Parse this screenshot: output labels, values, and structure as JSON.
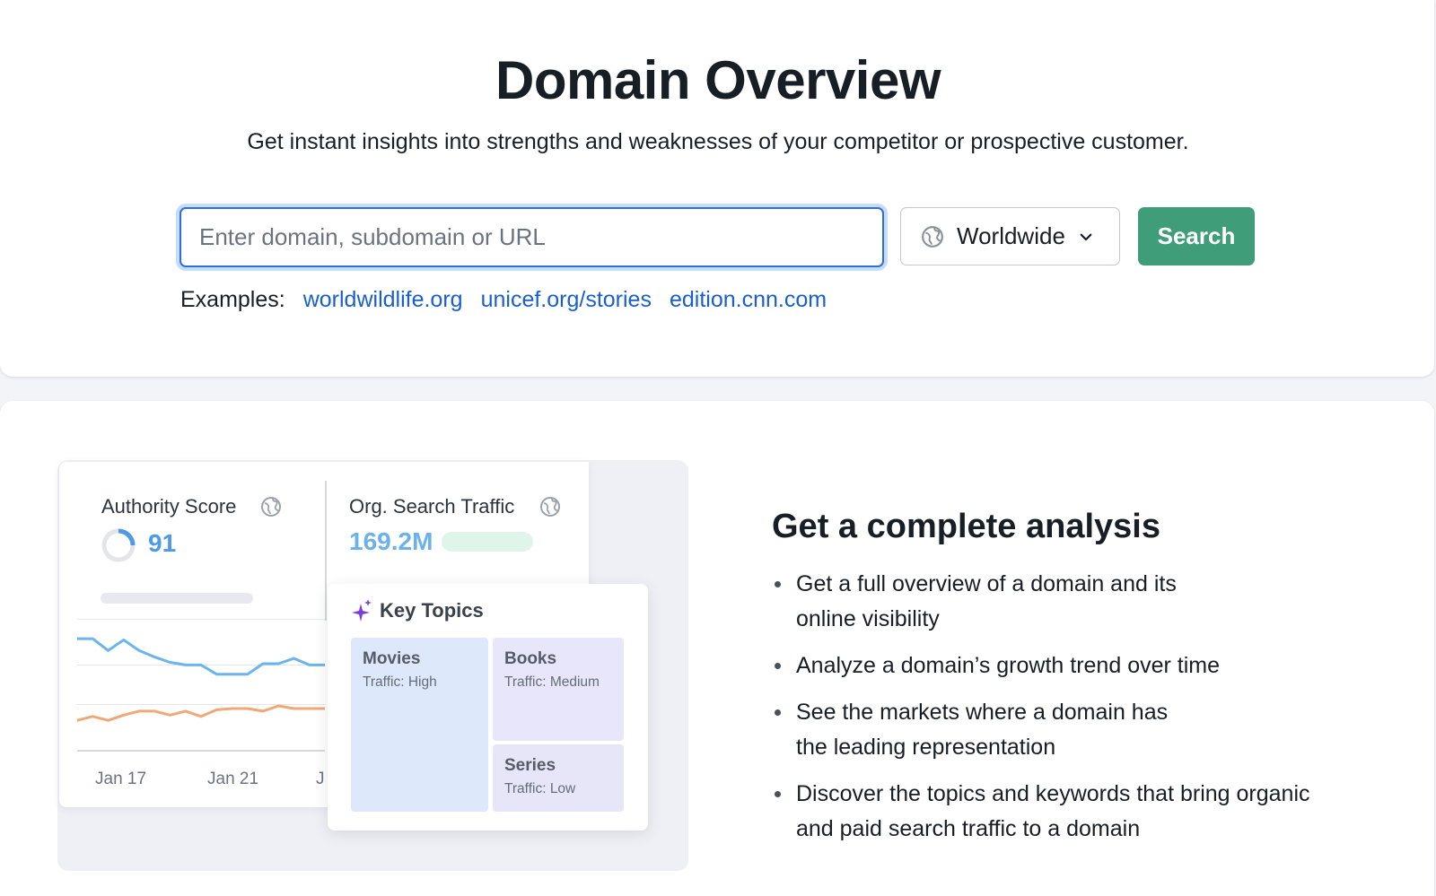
{
  "header": {
    "title": "Domain Overview",
    "subtitle": "Get instant insights into strengths and weaknesses of your competitor or prospective customer."
  },
  "search": {
    "placeholder": "Enter domain, subdomain or URL",
    "value": "",
    "region_label": "Worldwide",
    "region_icon": "globe-icon",
    "region_chevron_icon": "chevron-down-icon",
    "button_label": "Search"
  },
  "examples": {
    "label": "Examples:",
    "links": [
      "worldwildlife.org",
      "unicef.org/stories",
      "edition.cnn.com"
    ]
  },
  "illustration": {
    "authority_score": {
      "label": "Authority Score",
      "value": "91",
      "icon": "globe-icon"
    },
    "org_search_traffic": {
      "label": "Org. Search Traffic",
      "value": "169.2M",
      "icon": "globe-icon"
    },
    "chart_data": {
      "type": "line",
      "x": [
        "Jan 17",
        "Jan 21",
        "J"
      ],
      "series": [
        {
          "values": [
            30,
            30,
            21,
            29,
            21,
            16,
            12,
            10,
            10,
            3,
            3,
            3,
            11,
            11,
            15,
            10,
            10
          ]
        },
        {
          "values": [
            -32,
            -29,
            -32,
            -28,
            -25,
            -25,
            -28,
            -25,
            -29,
            -24,
            -23,
            -23,
            -25,
            -21,
            -23,
            -23,
            -23
          ]
        }
      ],
      "colors": [
        "#6cb4ee",
        "#f0a878"
      ],
      "grid": true
    },
    "key_topics": {
      "title": "Key Topics",
      "icon": "sparkle-icon",
      "tiles": [
        {
          "name": "Movies",
          "traffic": "Traffic: High",
          "color": "#dde8fb"
        },
        {
          "name": "Books",
          "traffic": "Traffic: Medium",
          "color": "#e8e6fa"
        },
        {
          "name": "Series",
          "traffic": "Traffic: Low",
          "color": "#e6e6f8"
        }
      ]
    }
  },
  "analysis": {
    "title": "Get a complete analysis",
    "bullets": [
      [
        "Get a full overview of a domain and its",
        "online visibility"
      ],
      [
        "Analyze a domain’s growth trend over time"
      ],
      [
        "See the markets where a domain has",
        "the leading representation"
      ],
      [
        "Discover the topics and keywords that bring organic",
        "and paid search traffic to a domain"
      ]
    ]
  },
  "colors": {
    "accent_blue": "#2b6fe0",
    "link": "#1a5fcc",
    "search_button": "#3f9d7a"
  }
}
